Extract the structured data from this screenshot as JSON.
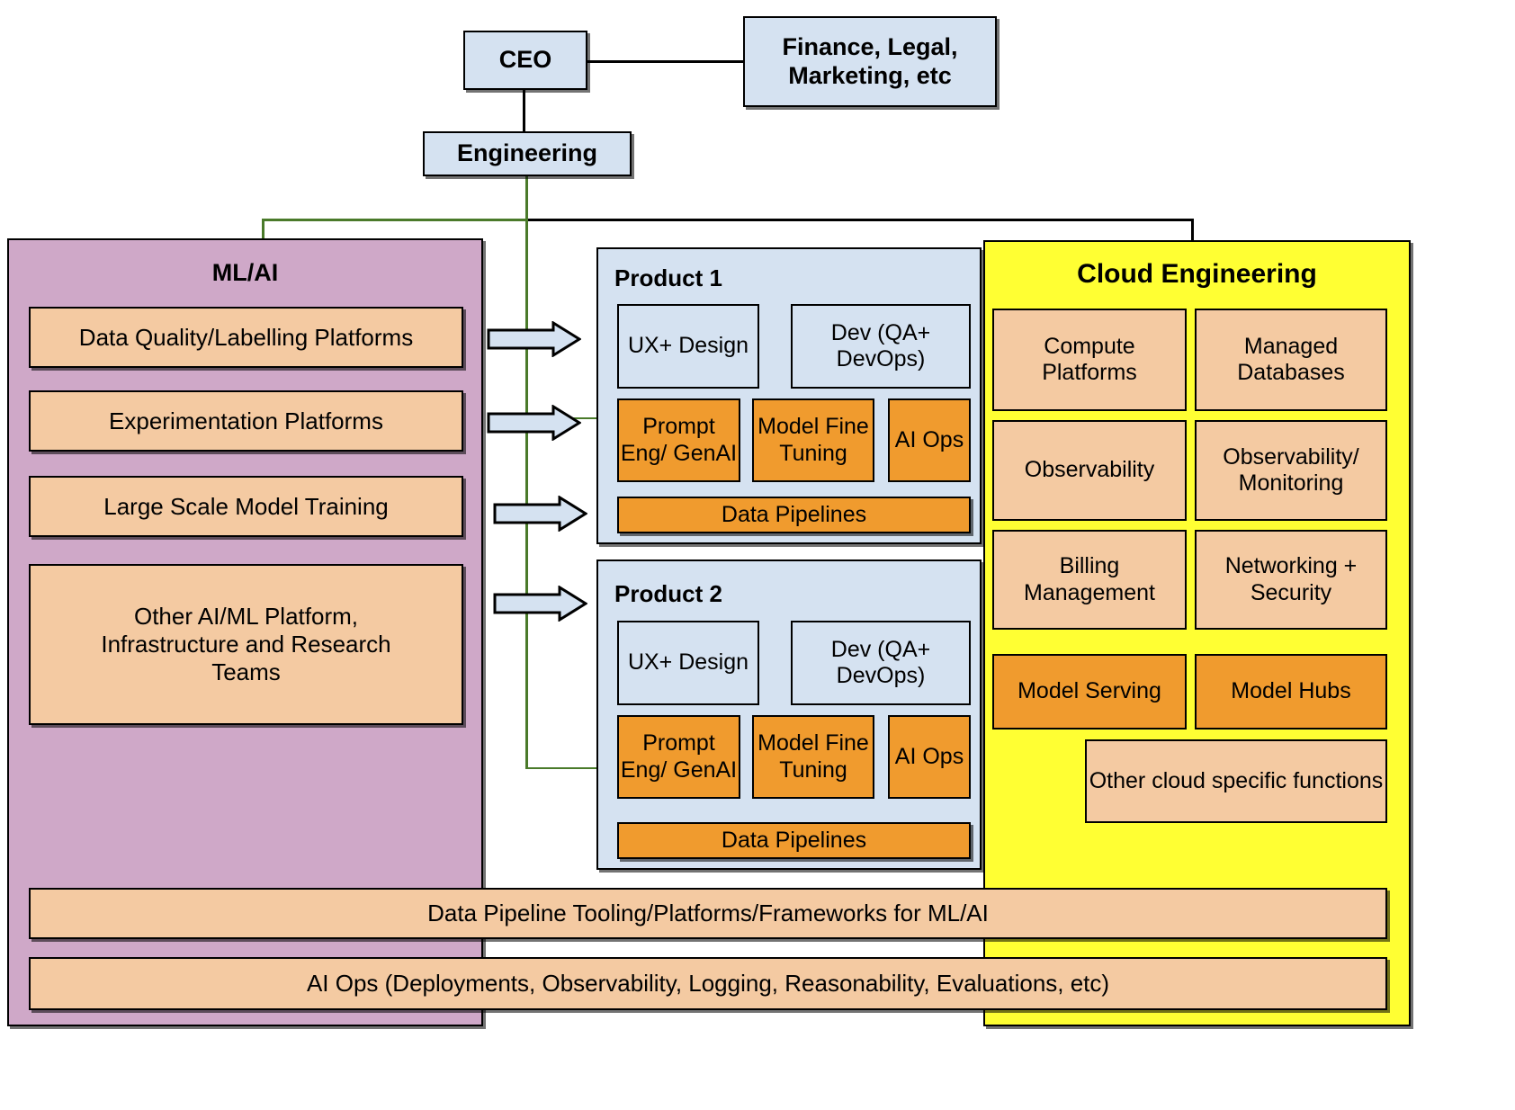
{
  "org": {
    "ceo": "CEO",
    "side_functions": "Finance, Legal, Marketing, etc",
    "engineering": "Engineering"
  },
  "mlai": {
    "title": "ML/AI",
    "items": [
      "Data Quality/Labelling Platforms",
      "Experimentation Platforms",
      "Large Scale Model Training",
      "Other AI/ML Platform, Infrastructure and Research Teams"
    ]
  },
  "products": [
    {
      "title": "Product 1",
      "blue_items": [
        "UX+ Design",
        "Dev (QA+ DevOps)"
      ],
      "orange_items": [
        "Prompt Eng/ GenAI",
        "Model Fine Tuning",
        "AI Ops"
      ],
      "footer": "Data Pipelines"
    },
    {
      "title": "Product 2",
      "blue_items": [
        "UX+ Design",
        "Dev (QA+ DevOps)"
      ],
      "orange_items": [
        "Prompt Eng/ GenAI",
        "Model Fine Tuning",
        "AI Ops"
      ],
      "footer": "Data Pipelines"
    }
  ],
  "cloud": {
    "title": "Cloud Engineering",
    "tan_items": [
      "Compute Platforms",
      "Managed Databases",
      "Observability",
      "Observability/ Monitoring",
      "Billing Management",
      "Networking + Security"
    ],
    "orange_items": [
      "Model Serving",
      "Model Hubs"
    ],
    "wide_item": "Other cloud specific functions"
  },
  "footers": {
    "data_pipeline_tooling": "Data Pipeline Tooling/Platforms/Frameworks for ML/AI",
    "ai_ops": "AI Ops (Deployments, Observability, Logging, Reasonability, Evaluations, etc)"
  },
  "colors": {
    "blue": "#d5e2f1",
    "purple": "#cfa8c8",
    "tan": "#f4caa2",
    "orange": "#f09b2e",
    "yellow": "#ffff33",
    "line_black": "#000000",
    "line_green": "#4a7a2a"
  }
}
